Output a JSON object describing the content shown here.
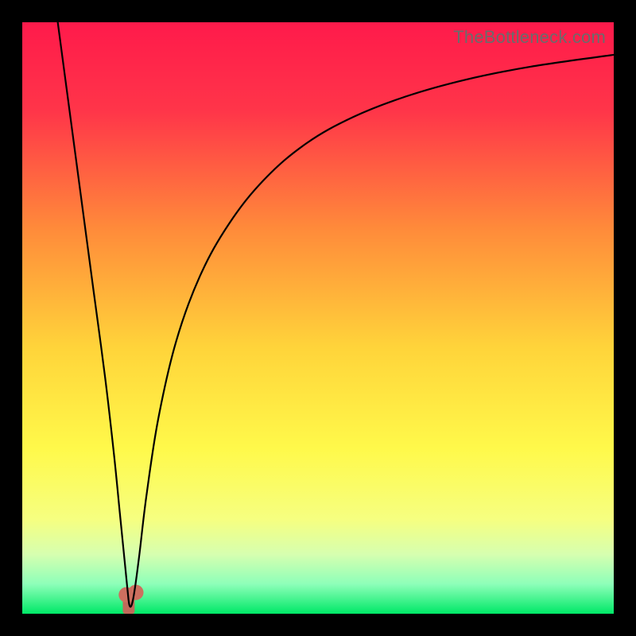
{
  "watermark": "TheBottleneck.com",
  "chart_data": {
    "type": "line",
    "title": "",
    "xlabel": "",
    "ylabel": "",
    "xlim": [
      0,
      100
    ],
    "ylim": [
      0,
      100
    ],
    "grid": false,
    "legend": false,
    "background_gradient": {
      "stops": [
        {
          "offset": 0.0,
          "color": "#ff1a4b"
        },
        {
          "offset": 0.15,
          "color": "#ff3549"
        },
        {
          "offset": 0.35,
          "color": "#ff8b3a"
        },
        {
          "offset": 0.55,
          "color": "#ffd43a"
        },
        {
          "offset": 0.72,
          "color": "#fff94a"
        },
        {
          "offset": 0.84,
          "color": "#f6ff80"
        },
        {
          "offset": 0.9,
          "color": "#d6ffb0"
        },
        {
          "offset": 0.95,
          "color": "#8dffb9"
        },
        {
          "offset": 1.0,
          "color": "#00e867"
        }
      ]
    },
    "series": [
      {
        "name": "bottleneck-curve",
        "stroke": "#000000",
        "stroke_width": 2.2,
        "x": [
          6.0,
          8.0,
          10.0,
          12.0,
          14.0,
          15.5,
          16.5,
          17.3,
          17.8,
          18.1,
          18.5,
          19.0,
          19.8,
          21.0,
          23.0,
          26.0,
          30.0,
          35.0,
          41.0,
          48.0,
          56.0,
          65.0,
          75.0,
          86.0,
          100.0
        ],
        "y": [
          100.0,
          85.0,
          70.0,
          55.0,
          40.0,
          27.0,
          17.0,
          9.0,
          4.0,
          1.5,
          1.5,
          4.0,
          10.0,
          20.0,
          33.0,
          46.0,
          57.0,
          66.0,
          73.5,
          79.5,
          84.0,
          87.5,
          90.3,
          92.5,
          94.5
        ]
      }
    ],
    "markers": [
      {
        "name": "dip-marker-1",
        "shape": "circle",
        "x": 17.6,
        "y": 3.2,
        "r": 1.3,
        "fill": "#cc6f5f"
      },
      {
        "name": "dip-marker-2",
        "shape": "circle",
        "x": 19.2,
        "y": 3.6,
        "r": 1.3,
        "fill": "#cc6f5f"
      }
    ],
    "bar": {
      "name": "dip-bar",
      "x": 17.0,
      "width": 2.0,
      "y0": 0.0,
      "y1": 4.2,
      "fill": "#c06a5a"
    }
  }
}
